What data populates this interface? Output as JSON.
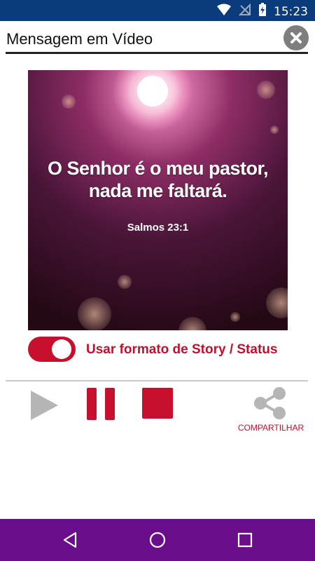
{
  "status_bar": {
    "time": "15:23",
    "icons": [
      "wifi-icon",
      "no-signal-icon",
      "battery-charging-icon"
    ],
    "background": "#0a3b7a"
  },
  "header": {
    "title": "Mensagem em Vídeo",
    "close_icon": "close-icon"
  },
  "verse": {
    "text_line1": "O Senhor é o meu pastor,",
    "text_line2": "nada me faltará.",
    "reference": "Salmos 23:1"
  },
  "story_toggle": {
    "label": "Usar formato de Story / Status",
    "checked": true,
    "accent": "#c8102e"
  },
  "controls": {
    "play_icon": "play-icon",
    "pause_icon": "pause-icon",
    "stop_icon": "stop-icon",
    "share_icon": "share-icon",
    "share_label": "COMPARTILHAR"
  },
  "nav_bar": {
    "background": "#6a0d8a",
    "buttons": [
      "back-icon",
      "home-icon",
      "recents-icon"
    ]
  }
}
